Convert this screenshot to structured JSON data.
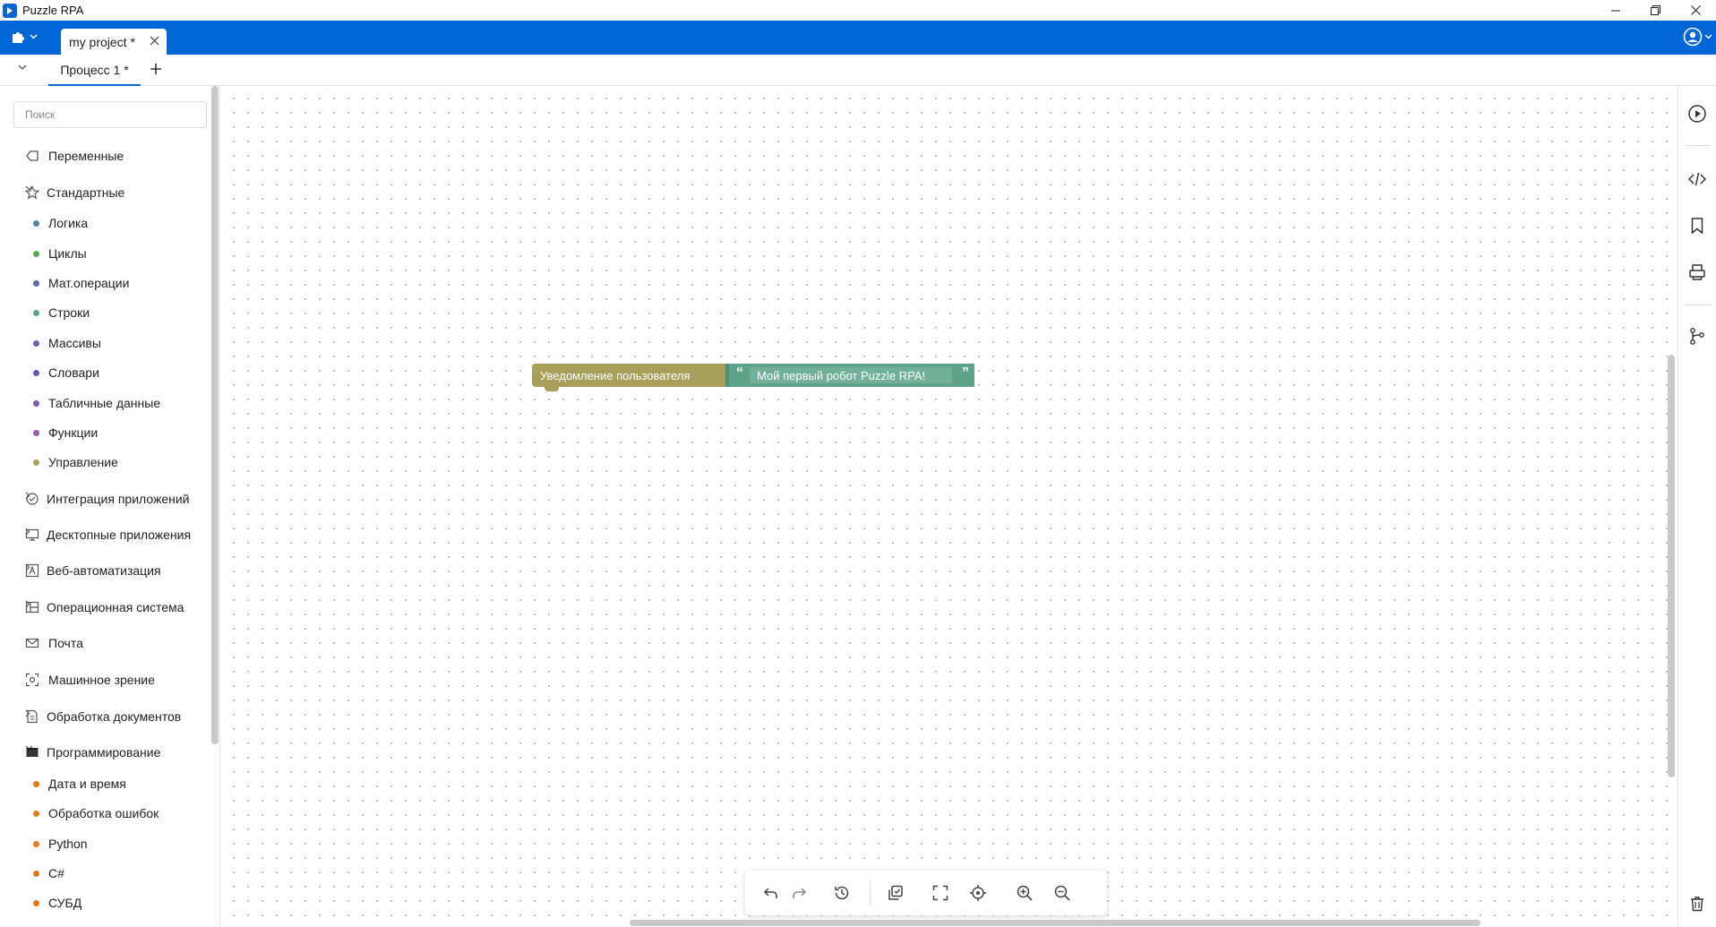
{
  "window": {
    "title": "Puzzle RPA"
  },
  "topbar": {
    "project_tab": "my project *"
  },
  "process_tabs": {
    "active": "Процесс 1 *"
  },
  "sidebar": {
    "search_placeholder": "Поиск",
    "categories": [
      {
        "label": "Переменные"
      },
      {
        "label": "Стандартные"
      },
      {
        "label": "Интеграция приложений"
      },
      {
        "label": "Десктопные приложения"
      },
      {
        "label": "Веб-автоматизация"
      },
      {
        "label": "Операционная система"
      },
      {
        "label": "Почта"
      },
      {
        "label": "Машинное зрение"
      },
      {
        "label": "Обработка документов"
      },
      {
        "label": "Программирование"
      }
    ],
    "standard_items": [
      {
        "label": "Логика",
        "color": "#5b80a5"
      },
      {
        "label": "Циклы",
        "color": "#5ba55b"
      },
      {
        "label": "Мат.операции",
        "color": "#5b67a5"
      },
      {
        "label": "Строки",
        "color": "#5ba58c"
      },
      {
        "label": "Массивы",
        "color": "#745ba5"
      },
      {
        "label": "Словари",
        "color": "#5b5ba5"
      },
      {
        "label": "Табличные данные",
        "color": "#7a5ba5"
      },
      {
        "label": "Функции",
        "color": "#995ba5"
      },
      {
        "label": "Управление",
        "color": "#a5a55b"
      }
    ],
    "programming_items": [
      {
        "label": "Дата и время",
        "color": "#e07b1f"
      },
      {
        "label": "Обработка ошибок",
        "color": "#e07b1f"
      },
      {
        "label": "Python",
        "color": "#e07b1f"
      },
      {
        "label": "C#",
        "color": "#e07b1f"
      },
      {
        "label": "СУБД",
        "color": "#e07b1f"
      }
    ]
  },
  "canvas": {
    "notify_block": "Уведомление пользователя",
    "string_block": "Мой первый робот Puzzle RPA!",
    "quote_open": "“",
    "quote_close": "”"
  },
  "colors": {
    "accent": "#0066d6",
    "notify_block": "#a6a05a",
    "string_block": "#5ea38a"
  }
}
